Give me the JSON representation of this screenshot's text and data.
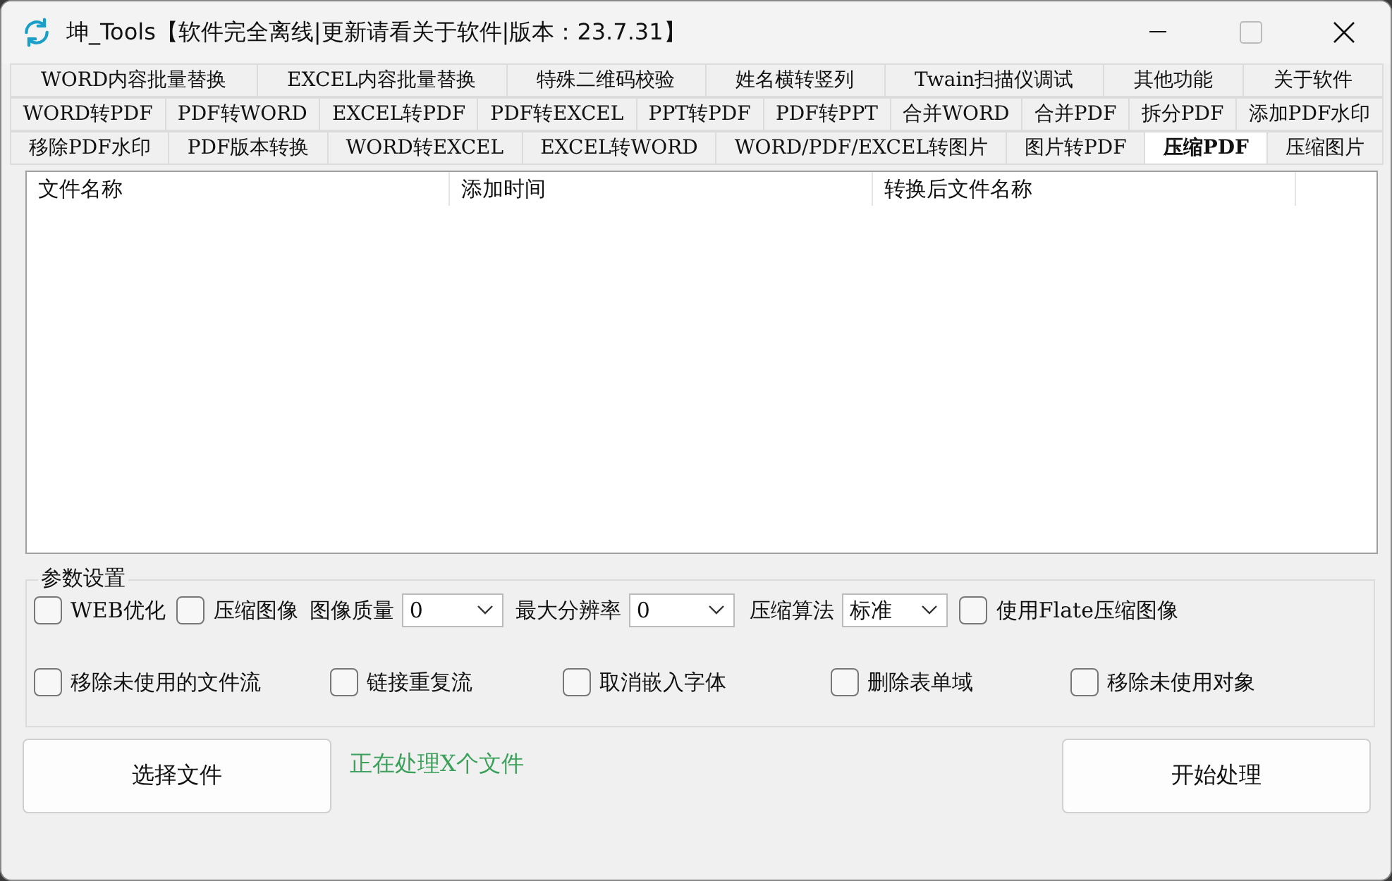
{
  "window": {
    "title": "坤_Tools【软件完全离线|更新请看关于软件|版本：23.7.31】"
  },
  "tab_rows": [
    [
      {
        "label": "WORD内容批量替换",
        "selected": false
      },
      {
        "label": "EXCEL内容批量替换",
        "selected": false
      },
      {
        "label": "特殊二维码校验",
        "selected": false
      },
      {
        "label": "姓名横转竖列",
        "selected": false
      },
      {
        "label": "Twain扫描仪调试",
        "selected": false
      },
      {
        "label": "其他功能",
        "selected": false
      },
      {
        "label": "关于软件",
        "selected": false
      }
    ],
    [
      {
        "label": "WORD转PDF",
        "selected": false
      },
      {
        "label": "PDF转WORD",
        "selected": false
      },
      {
        "label": "EXCEL转PDF",
        "selected": false
      },
      {
        "label": "PDF转EXCEL",
        "selected": false
      },
      {
        "label": "PPT转PDF",
        "selected": false
      },
      {
        "label": "PDF转PPT",
        "selected": false
      },
      {
        "label": "合并WORD",
        "selected": false
      },
      {
        "label": "合并PDF",
        "selected": false
      },
      {
        "label": "拆分PDF",
        "selected": false
      },
      {
        "label": "添加PDF水印",
        "selected": false
      }
    ],
    [
      {
        "label": "移除PDF水印",
        "selected": false
      },
      {
        "label": "PDF版本转换",
        "selected": false
      },
      {
        "label": "WORD转EXCEL",
        "selected": false
      },
      {
        "label": "EXCEL转WORD",
        "selected": false
      },
      {
        "label": "WORD/PDF/EXCEL转图片",
        "selected": false
      },
      {
        "label": "图片转PDF",
        "selected": false
      },
      {
        "label": "压缩PDF",
        "selected": true
      },
      {
        "label": "压缩图片",
        "selected": false
      }
    ]
  ],
  "table": {
    "columns": [
      "文件名称",
      "添加时间",
      "转换后文件名称"
    ]
  },
  "settings": {
    "title": "参数设置",
    "rows": [
      [
        {
          "kind": "checkbox",
          "label": "WEB优化",
          "checked": false
        },
        {
          "kind": "checkbox",
          "label": "压缩图像",
          "checked": false
        },
        {
          "kind": "select",
          "label": "图像质量",
          "value": "0"
        },
        {
          "kind": "select",
          "label": "最大分辨率",
          "value": "0"
        },
        {
          "kind": "select",
          "label": "压缩算法",
          "value": "标准"
        },
        {
          "kind": "checkbox",
          "label": "使用Flate压缩图像",
          "checked": false
        }
      ],
      [
        {
          "kind": "checkbox",
          "label": "移除未使用的文件流",
          "checked": false
        },
        {
          "kind": "checkbox",
          "label": "链接重复流",
          "checked": false
        },
        {
          "kind": "checkbox",
          "label": "取消嵌入字体",
          "checked": false
        },
        {
          "kind": "checkbox",
          "label": "删除表单域",
          "checked": false
        },
        {
          "kind": "checkbox",
          "label": "移除未使用对象",
          "checked": false
        }
      ]
    ]
  },
  "buttons": {
    "select": "选择文件",
    "start": "开始处理"
  },
  "status": "正在处理X个文件"
}
